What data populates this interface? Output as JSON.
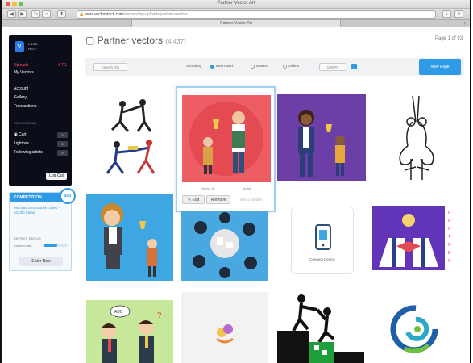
{
  "window": {
    "title": "Partner Vector Art",
    "tab_title": "Partner Vector Art",
    "url_host": "www.vectorstock.com",
    "url_path": "/vectors/my-uploads/partner-vectors",
    "new_tab": "+"
  },
  "toolbar": {
    "back": "◀",
    "forward": "▶",
    "reload": "↻",
    "home": "⌂"
  },
  "sidebar": {
    "user_line1": "LOGO",
    "user_line2": "HELP",
    "items": [
      {
        "label": "Uploads",
        "value": "4 7 1"
      },
      {
        "label": "My Vectors"
      },
      {
        "label": "Account"
      },
      {
        "label": "Gallery"
      },
      {
        "label": "Transactions"
      }
    ],
    "section_label": "COLLECTIONS",
    "counts": [
      {
        "label": "Cart",
        "value": "0"
      },
      {
        "label": "Lightbox",
        "value": "0"
      },
      {
        "label": "Following artists",
        "value": "0"
      }
    ],
    "logout": "Log Out"
  },
  "competition": {
    "title": "COMPETITION",
    "badge": "$50",
    "prize": "Win $50 SmartStock codes - 20,000 Ideas",
    "entries_label": "ENTRIES STATUS",
    "progress_label": "Contest date",
    "progress": 0.55,
    "enter_button": "Enter Now"
  },
  "header": {
    "title": "Partner vectors",
    "count": "(4,437)",
    "pager": "Page 1 of 93"
  },
  "filters": {
    "search_placeholder": "Search title",
    "view_label": "Sorted by",
    "radio_options": [
      "Best match",
      "Newest",
      "Oldest"
    ],
    "radio_selected": 0,
    "per_page": "100/PP",
    "new_button": "New Page"
  },
  "active_tile": {
    "left_meta": "Vector ID",
    "right_meta": "Artist",
    "edit_button": "Edit",
    "remove_button": "Remove",
    "scope_label": "Set to partner"
  },
  "tiles": [
    {
      "name": "dancing-couple-tile"
    },
    {
      "name": "partner-trophy-tile"
    },
    {
      "name": "woman-trophy-tile"
    },
    {
      "name": "yoga-partners-tile"
    },
    {
      "name": "businesswoman-idea-tile"
    },
    {
      "name": "teamwork-top-view-tile"
    },
    {
      "name": "phone-app-tile",
      "caption": "Connect Device"
    },
    {
      "name": "handshake-idea-tile"
    },
    {
      "name": "business-partners-chat-tile",
      "bubble": "ABC"
    },
    {
      "name": "hands-logo-tile"
    },
    {
      "name": "climbing-help-tile"
    },
    {
      "name": "swirl-logo-tile"
    }
  ]
}
